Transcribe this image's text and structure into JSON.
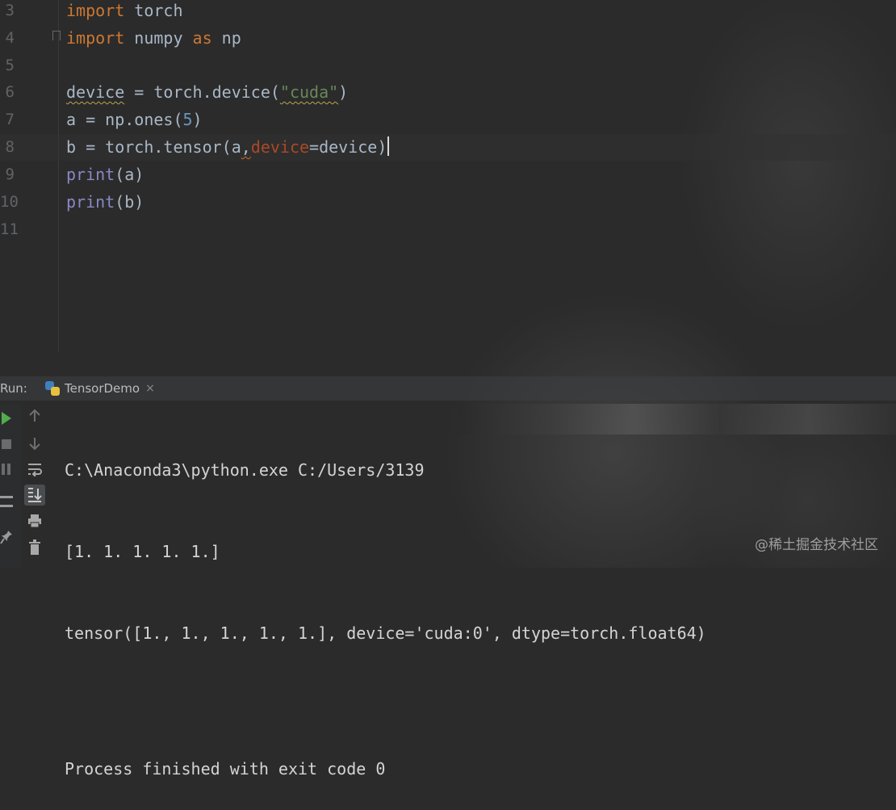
{
  "editor": {
    "lines": [
      {
        "num": "3"
      },
      {
        "num": "4"
      },
      {
        "num": "5"
      },
      {
        "num": "6"
      },
      {
        "num": "7"
      },
      {
        "num": "8"
      },
      {
        "num": "9"
      },
      {
        "num": "10"
      },
      {
        "num": "11"
      }
    ],
    "tokens": {
      "l3_kw": "import",
      "l3_rest": " torch",
      "l4_kw": "import",
      "l4_mid": " numpy ",
      "l4_as": "as",
      "l4_rest": " np",
      "l6_a": "device",
      "l6_b": " = torch.device(",
      "l6_str": "\"cuda\"",
      "l6_c": ")",
      "l7_a": "a = np.ones(",
      "l7_num": "5",
      "l7_b": ")",
      "l8_a": "b = torch.tensor(a",
      "l8_comma": ",",
      "l8_param": "device",
      "l8_b": "=device)",
      "l9_fn": "print",
      "l9_rest": "(a)",
      "l10_fn": "print",
      "l10_rest": "(b)"
    }
  },
  "run": {
    "label": "Run:",
    "tab_name": "TensorDemo",
    "tab_close": "×",
    "output": [
      "C:\\Anaconda3\\python.exe C:/Users/3139",
      "[1. 1. 1. 1. 1.]",
      "tensor([1., 1., 1., 1., 1.], device='cuda:0', dtype=torch.float64)",
      "",
      "Process finished with exit code 0"
    ]
  },
  "watermark": "@稀土掘金技术社区",
  "icons": {
    "rerun": "play-icon",
    "stop": "stop-icon",
    "pause": "pause-icon",
    "up": "arrow-up-icon",
    "down": "arrow-down-icon",
    "wrap": "soft-wrap-icon",
    "scroll_end": "scroll-to-end-icon",
    "print": "print-icon",
    "trash": "trash-icon",
    "layout": "layout-icon",
    "pin": "pin-icon",
    "python": "python-icon"
  }
}
